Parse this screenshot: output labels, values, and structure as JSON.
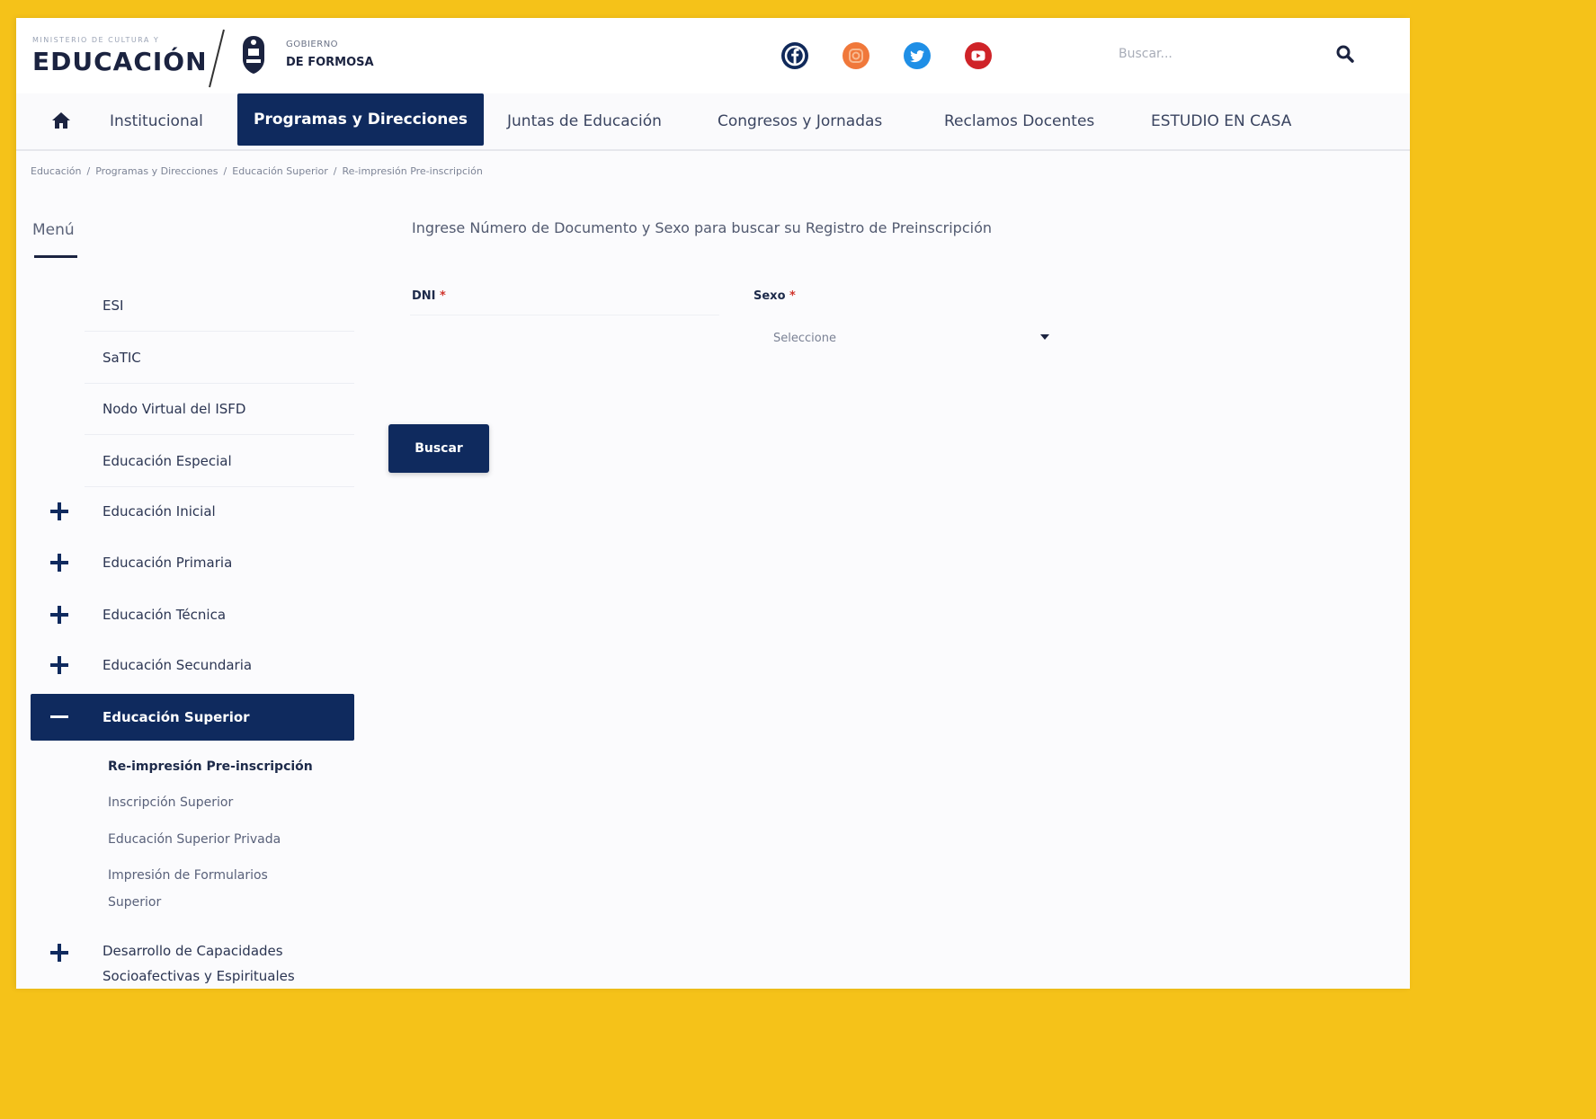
{
  "header": {
    "ministry_small": "MINISTERIO DE CULTURA Y",
    "brand": "EDUCACIÓN",
    "gov_line1": "GOBIERNO",
    "gov_line2": "DE FORMOSA",
    "social": [
      {
        "name": "facebook-icon",
        "color": "#10295a"
      },
      {
        "name": "instagram-icon",
        "color": "#f0783a"
      },
      {
        "name": "twitter-icon",
        "color": "#1f8fe6"
      },
      {
        "name": "youtube-icon",
        "color": "#cf2328"
      }
    ],
    "search_placeholder": "Buscar..."
  },
  "nav": {
    "items": [
      {
        "label": "Institucional"
      },
      {
        "label": "Programas y Direcciones",
        "active": true
      },
      {
        "label": "Juntas de Educación"
      },
      {
        "label": "Congresos y Jornadas"
      },
      {
        "label": "Reclamos Docentes"
      },
      {
        "label": "ESTUDIO EN CASA"
      }
    ]
  },
  "breadcrumb": [
    "Educación",
    "Programas y Direcciones",
    "Educación Superior",
    "Re-impresión Pre-inscripción"
  ],
  "sidebar": {
    "title": "Menú",
    "plain_items": [
      "ESI",
      "SaTIC",
      "Nodo Virtual del ISFD",
      "Educación Especial"
    ],
    "expandable_items": [
      "Educación Inicial",
      "Educación Primaria",
      "Educación Técnica",
      "Educación Secundaria"
    ],
    "active_item": "Educación Superior",
    "sub_items": [
      "Re-impresión Pre-inscripción",
      "Inscripción Superior",
      "Educación Superior Privada",
      "Impresión de Formularios Superior"
    ],
    "last_item": "Desarrollo de Capacidades Socioafectivas y Espirituales"
  },
  "main": {
    "title": "Ingrese Número de Documento y Sexo para buscar su Registro de Preinscripción",
    "dni_label": "DNI",
    "sexo_label": "Sexo",
    "required_mark": "*",
    "sexo_selected": "Seleccione",
    "submit_label": "Buscar"
  },
  "colors": {
    "primary": "#0f2a5e",
    "frame": "#f5c219"
  }
}
